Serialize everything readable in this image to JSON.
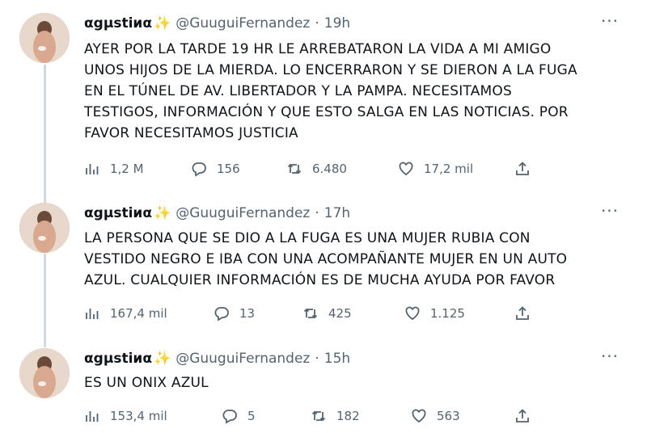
{
  "user": {
    "name": "αgμstiиα",
    "sparkle": "✨",
    "handle": "@GuuguiFernandez"
  },
  "tweets": [
    {
      "time": "19h",
      "lines": [
        "AYER POR LA TARDE 19 HR LE ARREBATARON LA VIDA A MI AMIGO",
        "UNOS HIJOS DE LA MIERDA. LO ENCERRARON Y SE DIERON A LA FUGA",
        "EN EL TÚNEL DE AV. LIBERTADOR Y LA PAMPA. NECESITAMOS",
        "TESTIGOS, INFORMACIÓN Y QUE ESTO SALGA EN LAS NOTICIAS. POR",
        "FAVOR NECESITAMOS JUSTICIA"
      ],
      "views": "1,2 M",
      "replies": "156",
      "retweets": "6.480",
      "likes": "17,2 mil"
    },
    {
      "time": "17h",
      "lines": [
        "LA PERSONA QUE SE DIO A LA FUGA ES UNA MUJER RUBIA CON",
        "VESTIDO NEGRO E IBA CON UNA ACOMPAÑANTE MUJER EN UN AUTO",
        "AZUL. CUALQUIER INFORMACIÓN ES DE MUCHA AYUDA POR FAVOR"
      ],
      "views": "167,4 mil",
      "replies": "13",
      "retweets": "425",
      "likes": "1.125"
    },
    {
      "time": "15h",
      "lines": [
        "ES UN ONIX AZUL"
      ],
      "views": "153,4 mil",
      "replies": "5",
      "retweets": "182",
      "likes": "563"
    }
  ],
  "icons": {
    "views": "views-chart-icon",
    "reply": "reply-icon",
    "retweet": "retweet-icon",
    "like": "heart-icon",
    "share": "share-icon",
    "more": "more-icon"
  },
  "colors": {
    "text": "#0f1419",
    "muted": "#536471",
    "thread_line": "#cfd9de",
    "sparkle": "#f4b400"
  }
}
